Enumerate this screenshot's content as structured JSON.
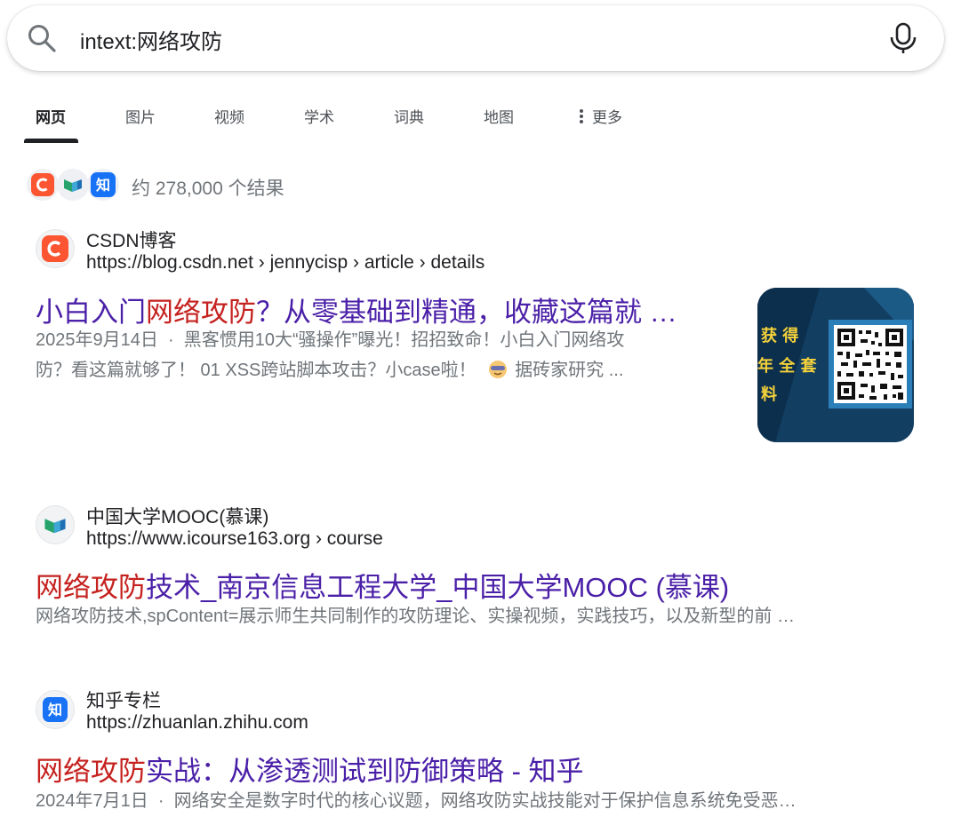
{
  "search": {
    "query": "intext:网络攻防"
  },
  "tabs": [
    {
      "label": "网页"
    },
    {
      "label": "图片"
    },
    {
      "label": "视频"
    },
    {
      "label": "学术"
    },
    {
      "label": "词典"
    },
    {
      "label": "地图"
    },
    {
      "label": "更多"
    }
  ],
  "stats": {
    "text": "约 278,000 个结果"
  },
  "results": [
    {
      "site": "CSDN博客",
      "url": "https://blog.csdn.net › jennycisp › article › details",
      "title_hl": "网络攻防",
      "title_pre": "小白入门",
      "title_post": "？从零基础到精通，收藏这篇就 …",
      "date": "2025年9月14日",
      "snippet_line1": "黑客惯用10大“骚操作”曝光！招招致命！小白入门网络攻",
      "snippet_line2": "防？看这篇就够了！ 01 XSS跨站脚本攻击？小case啦！",
      "snippet_tail": "据砖家研究 ...",
      "thumb_text1": "获 得",
      "thumb_text2": "年 全 套",
      "thumb_text3": "料"
    },
    {
      "site": "中国大学MOOC(慕课)",
      "url": "https://www.icourse163.org › course",
      "title_hl": "网络攻防",
      "title_post": "技术_南京信息工程大学_中国大学MOOC (慕课)",
      "snippet": "网络攻防技术,spContent=展示师生共同制作的攻防理论、实操视频，实践技巧，以及新型的前 …"
    },
    {
      "site": "知乎专栏",
      "url": "https://zhuanlan.zhihu.com",
      "title_hl": "网络攻防",
      "title_post": "实战：从渗透测试到防御策略 - 知乎",
      "date": "2024年7月1日",
      "snippet": "网络安全是数字时代的核心议题，网络攻防实战技能对于保护信息系统免受恶…"
    }
  ],
  "colors": {
    "title": "#4b20a8",
    "highlight": "#c5221f",
    "csdn": "#fc5531",
    "zhihu": "#1772f6"
  },
  "icons": [
    "search-icon",
    "microphone-icon",
    "more-dots-icon",
    "csdn-logo-icon",
    "mooc-logo-icon",
    "zhihu-logo-icon",
    "emoji-icon"
  ]
}
